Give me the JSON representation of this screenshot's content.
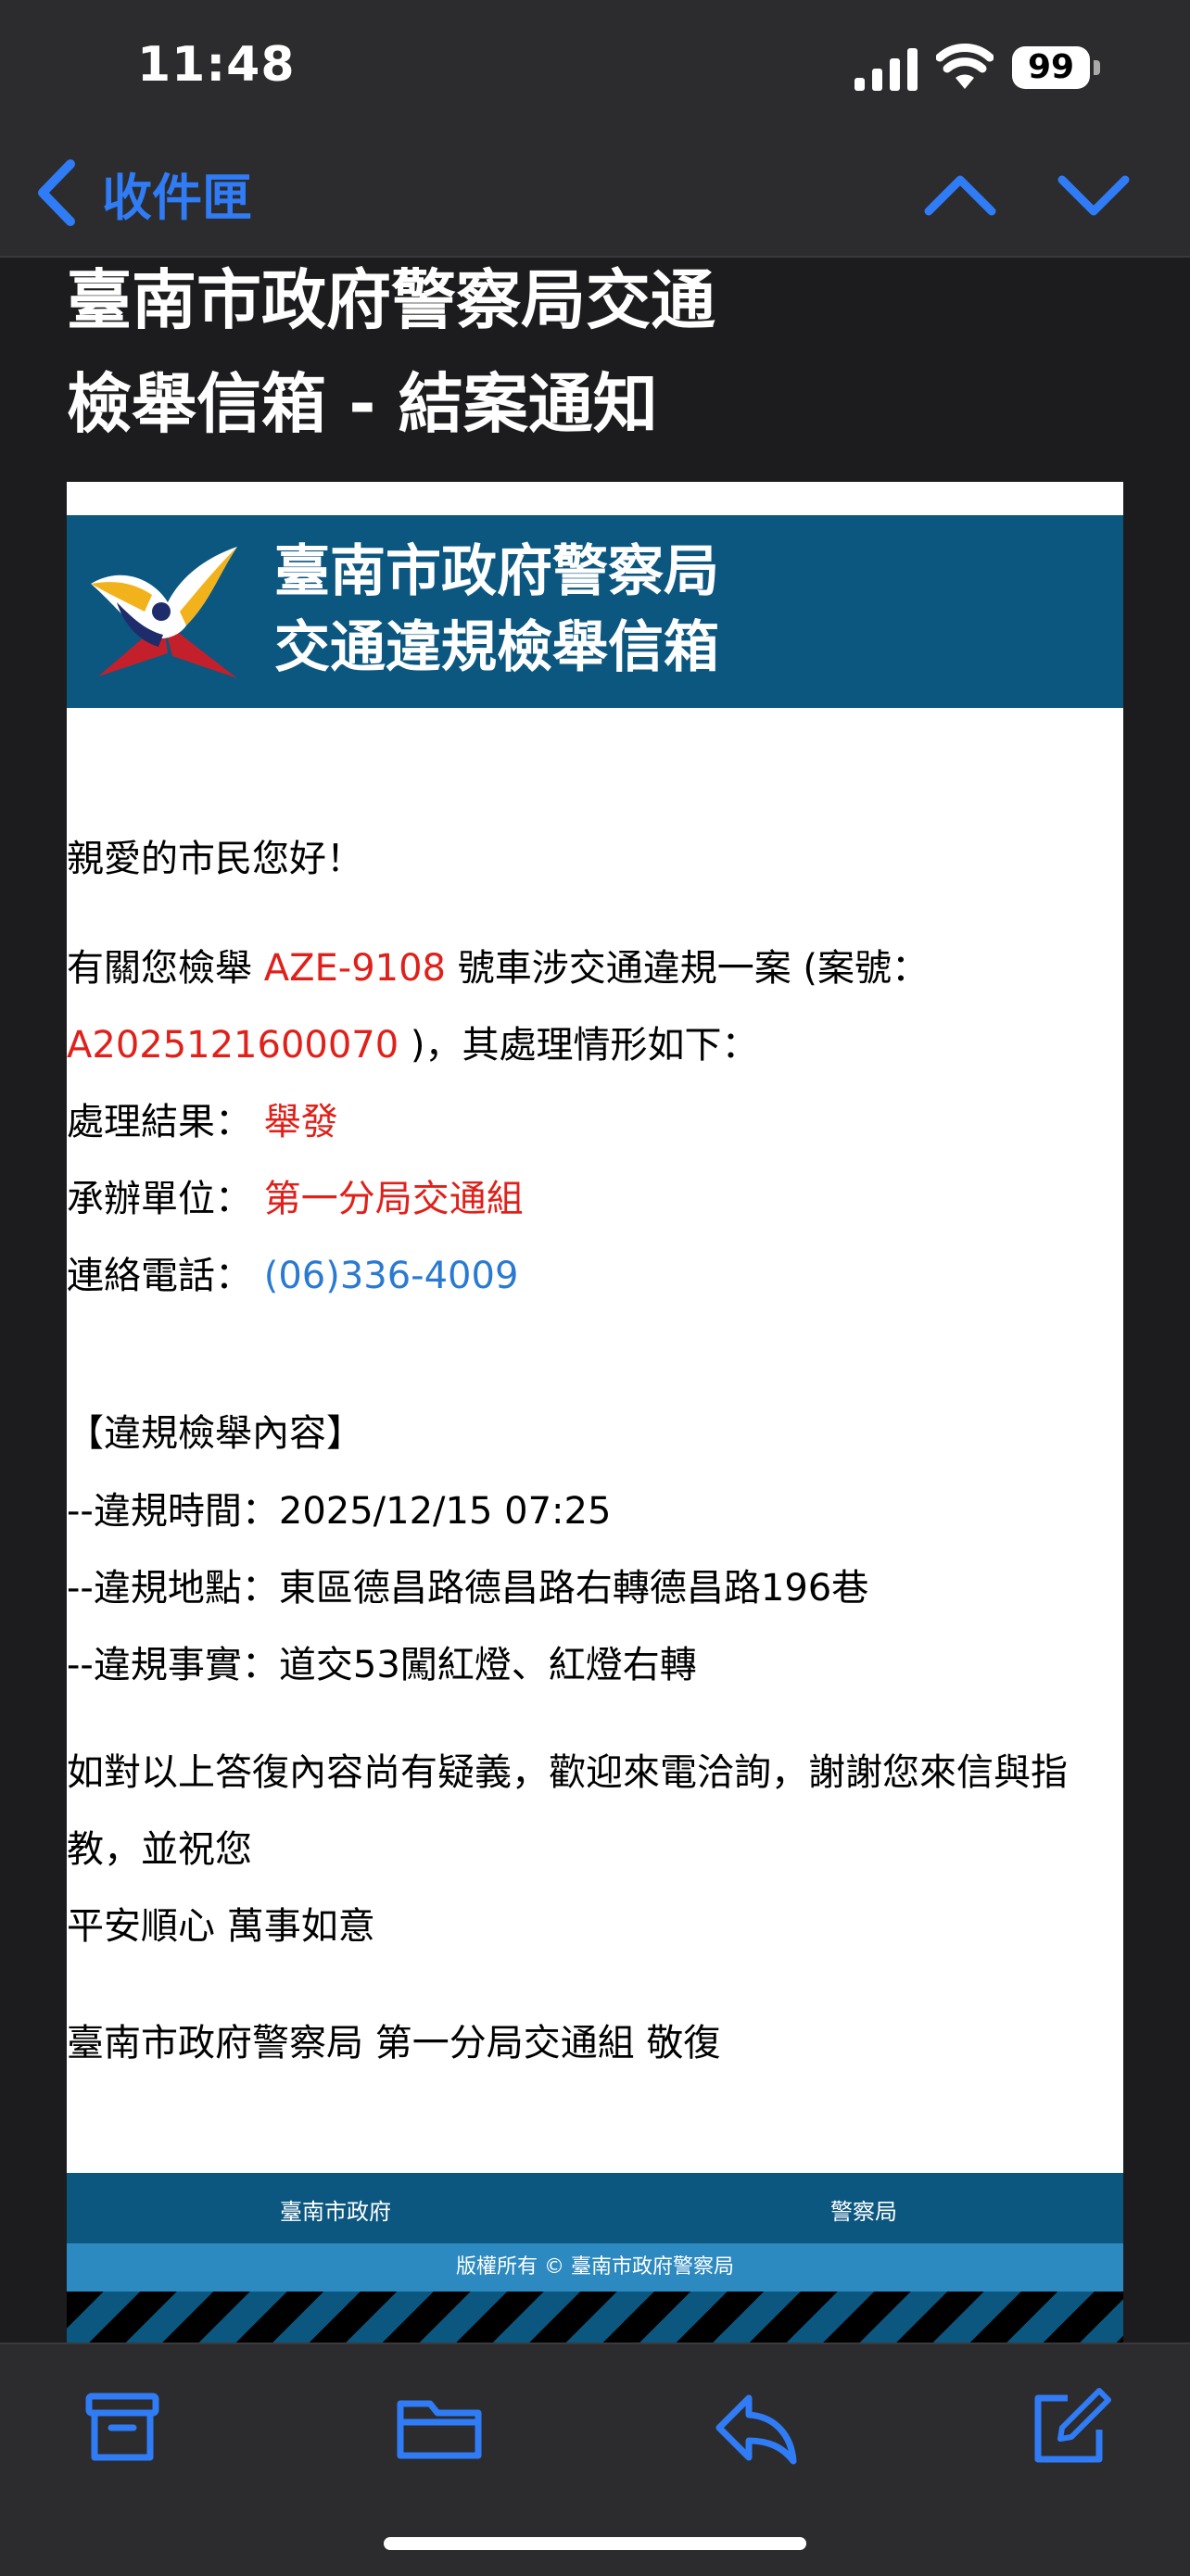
{
  "status_bar": {
    "time": "11:48",
    "battery": "99"
  },
  "nav": {
    "back_label": "收件匣"
  },
  "email": {
    "subject_line1": "臺南市政府警察局交通",
    "subject_line2": "檢舉信箱 - 結案通知",
    "banner_line1": "臺南市政府警察局",
    "banner_line2": "交通違規檢舉信箱",
    "greeting": "親愛的市民您好！",
    "case_intro_prefix": "有關您檢舉 ",
    "plate": "AZE-9108",
    "case_intro_suffix": " 號車涉交通違規一案 (案號：",
    "case_number": "A2025121600070",
    "case_intro_end": " )，其處理情形如下：",
    "result_label": "處理結果：",
    "result_value": "舉發",
    "unit_label": "承辦單位：",
    "unit_value": "第一分局交通組",
    "phone_label": "連絡電話：",
    "phone_value": "(06)336-4009",
    "section_title": "【違規檢舉內容】",
    "violation_time": "--違規時間：2025/12/15 07:25",
    "violation_place": "--違規地點：東區德昌路德昌路右轉德昌路196巷",
    "violation_fact": "--違規事實：道交53闖紅燈、紅燈右轉",
    "closing_line1": "如對以上答復內容尚有疑義，歡迎來電洽詢，謝謝您來信與指",
    "closing_line2": "教，並祝您",
    "closing_line3": "平安順心 萬事如意",
    "signature": "臺南市政府警察局 第一分局交通組 敬復",
    "footer_city": "臺南市政府",
    "footer_police": "警察局",
    "copyright": "版權所有 © 臺南市政府警察局"
  },
  "colors": {
    "accent": "#2f7cf6",
    "banner": "#0b5780",
    "red": "#e0201a",
    "link": "#2a7ad2"
  },
  "toolbar": {
    "icons": [
      "archive-icon",
      "folder-icon",
      "reply-icon",
      "compose-icon"
    ]
  }
}
